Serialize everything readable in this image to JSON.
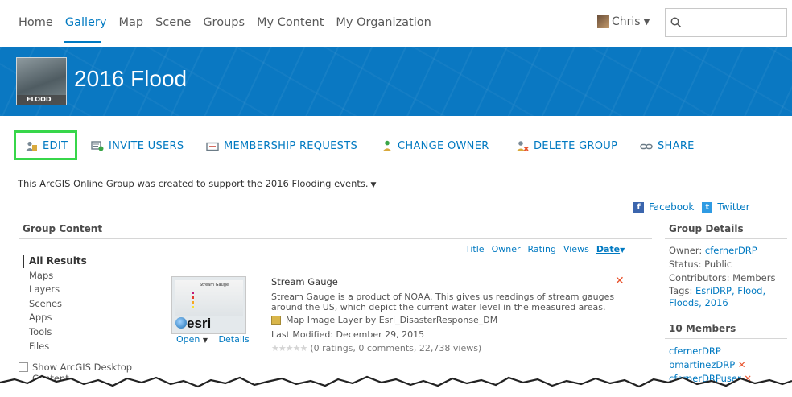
{
  "nav": {
    "items": [
      "Home",
      "Gallery",
      "Map",
      "Scene",
      "Groups",
      "My Content",
      "My Organization"
    ],
    "active": "Gallery",
    "user": "Chris"
  },
  "banner": {
    "thumb_tag": "FLOOD",
    "title": "2016 Flood",
    "color": "#0a78c2"
  },
  "toolbar": {
    "edit": "EDIT",
    "invite": "INVITE USERS",
    "membership": "MEMBERSHIP REQUESTS",
    "owner": "CHANGE OWNER",
    "delete": "DELETE GROUP",
    "share": "SHARE"
  },
  "description": "This ArcGIS Online Group was created to support the 2016 Flooding events.",
  "social": {
    "facebook": "Facebook",
    "twitter": "Twitter"
  },
  "content": {
    "heading": "Group Content",
    "sort": [
      "Title",
      "Owner",
      "Rating",
      "Views"
    ],
    "sort_active": "Date",
    "filters": [
      "All Results",
      "Maps",
      "Layers",
      "Scenes",
      "Apps",
      "Tools",
      "Files"
    ],
    "desktop_label": "Show ArcGIS Desktop Content",
    "item": {
      "title": "Stream Gauge",
      "description": "Stream Gauge is a product of NOAA. This gives us readings of stream gauges around the US, which depict the current water level in the measured areas.",
      "type": "Map Image Layer by Esri_DisasterResponse_DM",
      "modified": "Last Modified: December 29, 2015",
      "rating": "(0 ratings, 0 comments, 22,738 views)",
      "open": "Open",
      "details": "Details",
      "thumb_brand": "esri",
      "thumb_caption": "Stream Gauge"
    }
  },
  "details": {
    "heading": "Group Details",
    "owner_label": "Owner: ",
    "owner": "cfernerDRP",
    "status": "Status: Public",
    "contributors": "Contributors: Members",
    "tags_label": "Tags: ",
    "tags": "EsriDRP, Flood, Floods, 2016",
    "members_heading": "10 Members",
    "members": [
      "cfernerDRP",
      "bmartinezDRP",
      "cfernerDRPuser"
    ]
  },
  "colors": {
    "link": "#0079c1",
    "highlight": "#37d64a",
    "remove": "#e8532d"
  }
}
